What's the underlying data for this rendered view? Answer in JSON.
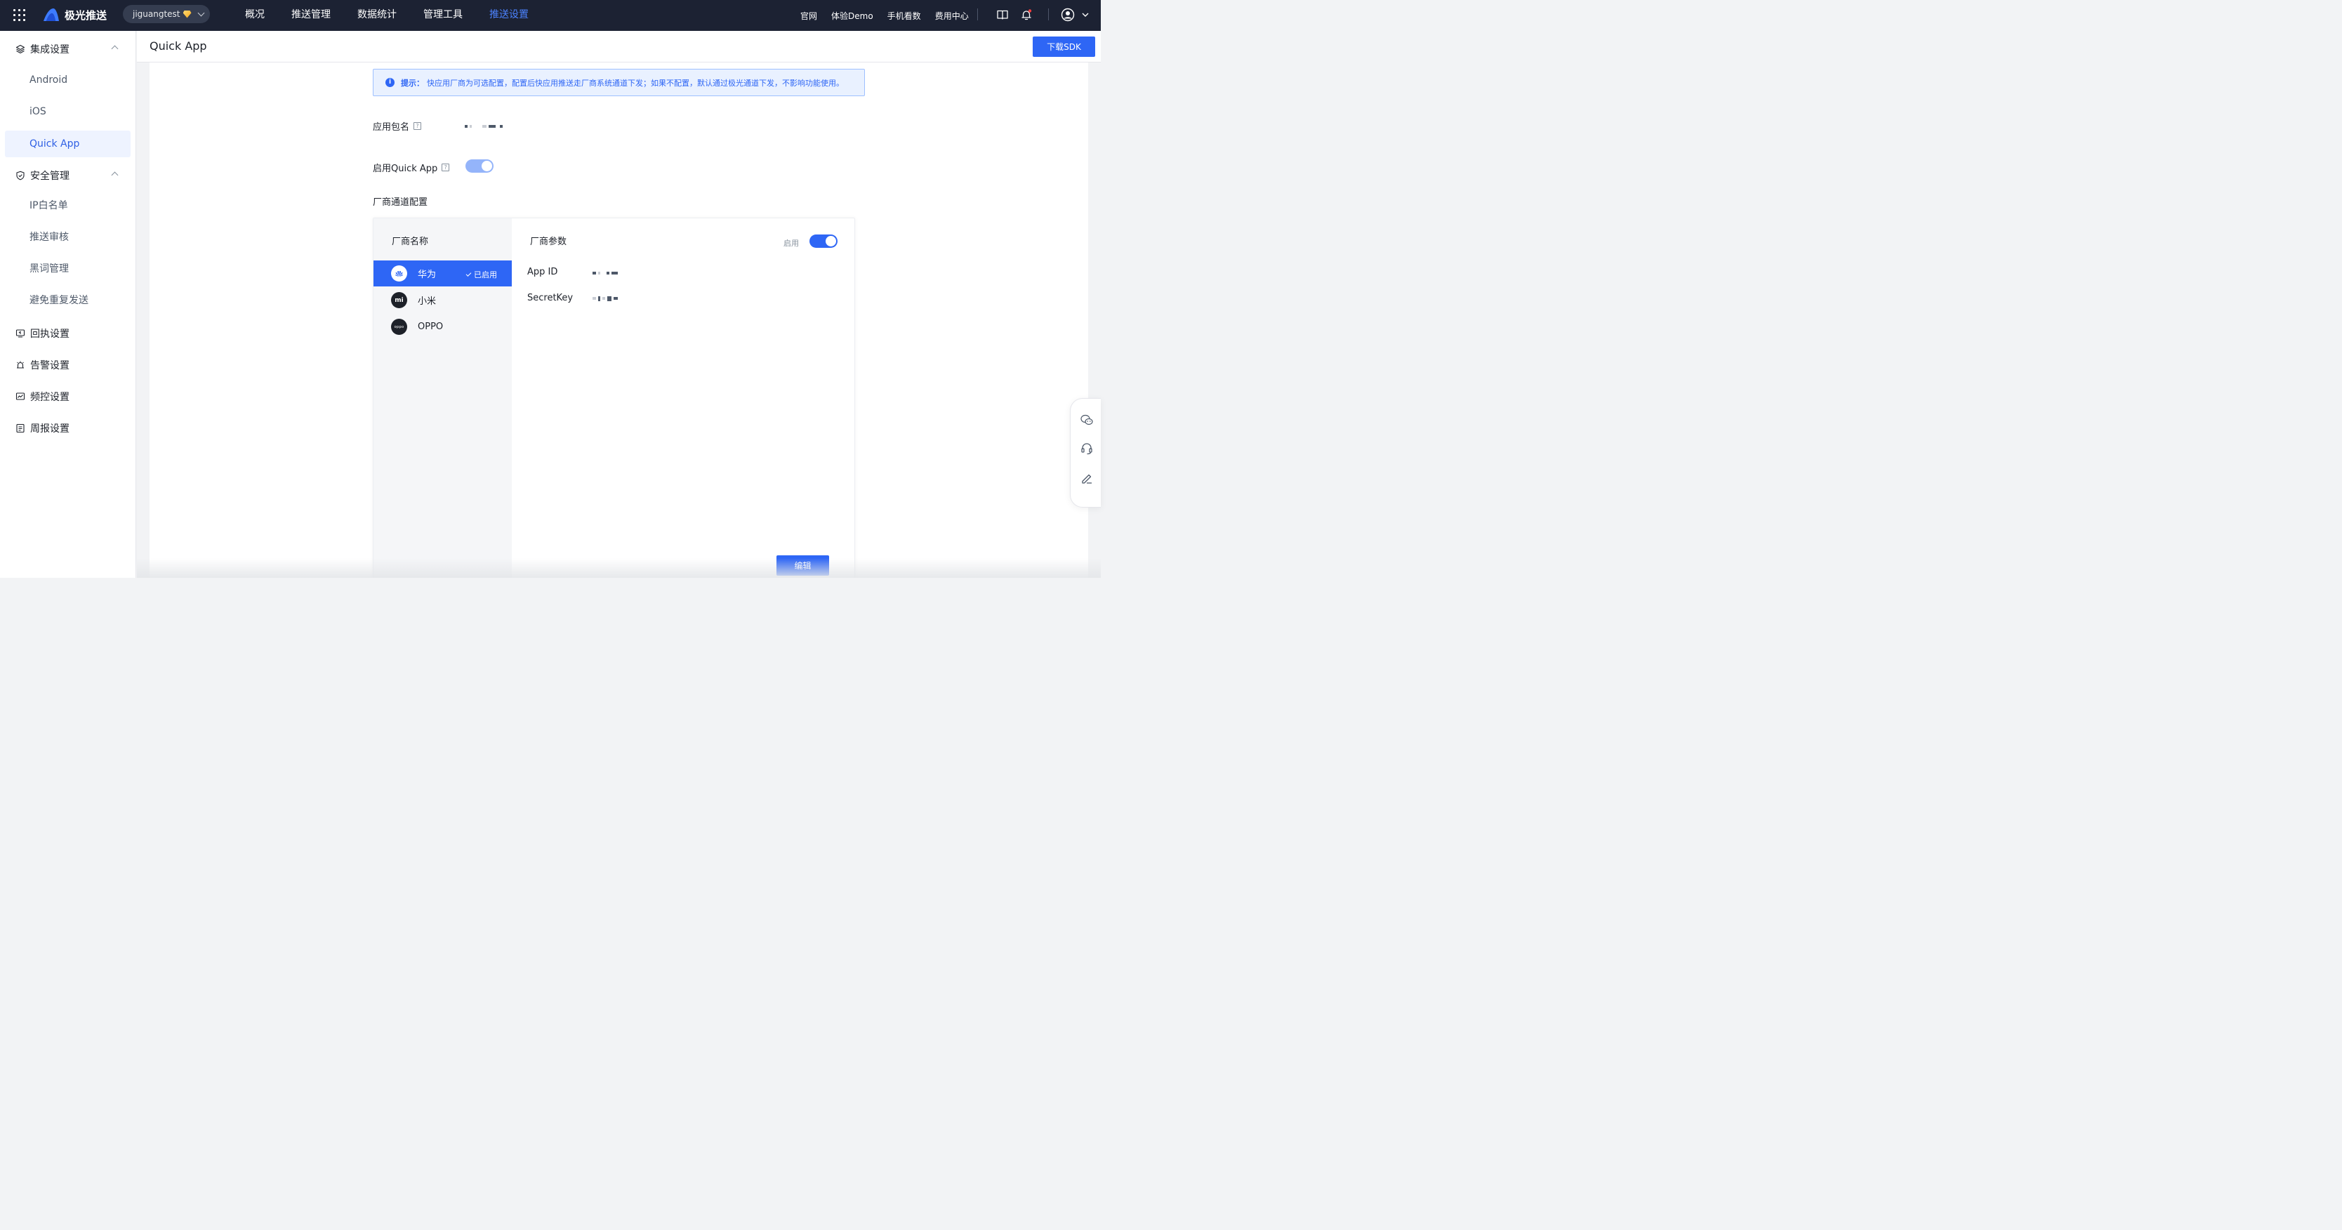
{
  "topbar": {
    "logo_text": "极光推送",
    "app_name": "jiguangtest",
    "nav": [
      {
        "label": "概况"
      },
      {
        "label": "推送管理"
      },
      {
        "label": "数据统计"
      },
      {
        "label": "管理工具"
      },
      {
        "label": "推送设置",
        "active": true
      }
    ],
    "links": [
      "官网",
      "体验Demo",
      "手机看数",
      "费用中心"
    ],
    "icons": [
      "apps-grid-icon",
      "book-icon",
      "bell-icon",
      "user-avatar-icon",
      "chevron-down-icon"
    ],
    "colors": {
      "background": "#1c2233",
      "active_nav": "#4c83ff",
      "notification_dot": "#f53f3f"
    }
  },
  "sidebar": {
    "groups": [
      {
        "label": "集成设置",
        "icon": "layers-icon",
        "expanded": true,
        "items": [
          {
            "label": "Android"
          },
          {
            "label": "iOS"
          },
          {
            "label": "Quick App",
            "active": true
          }
        ]
      },
      {
        "label": "安全管理",
        "icon": "shield-icon",
        "expanded": true,
        "items": [
          {
            "label": "IP白名单"
          },
          {
            "label": "推送审核"
          },
          {
            "label": "黑词管理"
          },
          {
            "label": "避免重复发送"
          }
        ]
      },
      {
        "label": "回执设置",
        "icon": "receipt-icon"
      },
      {
        "label": "告警设置",
        "icon": "alarm-icon"
      },
      {
        "label": "频控设置",
        "icon": "frequency-icon"
      },
      {
        "label": "周报设置",
        "icon": "report-icon"
      }
    ]
  },
  "page": {
    "title": "Quick App",
    "download_sdk": "下载SDK"
  },
  "tip": {
    "label": "提示：",
    "text": "快应用厂商为可选配置，配置后快应用推送走厂商系统通道下发；如果不配置，默认通过极光通道下发，不影响功能使用。"
  },
  "form": {
    "package_label": "应用包名",
    "enable_label": "启用Quick App",
    "enable_on": true,
    "vendor_section_title": "厂商通道配置"
  },
  "vendors": {
    "list_title": "厂商名称",
    "items": [
      {
        "name": "华为",
        "logo": "huawei-logo-icon",
        "enabled_tag": "已启用",
        "active": true
      },
      {
        "name": "小米",
        "logo": "xiaomi-logo-icon",
        "logo_text": "mi"
      },
      {
        "name": "OPPO",
        "logo": "oppo-logo-icon",
        "logo_text": "oppo"
      }
    ]
  },
  "params": {
    "title": "厂商参数",
    "enable_label": "启用",
    "enable_on": true,
    "fields": [
      {
        "label": "App ID"
      },
      {
        "label": "SecretKey"
      }
    ],
    "edit_button": "编辑"
  },
  "float_bar": {
    "icons": [
      "wechat-icon",
      "headset-support-icon",
      "edit-feedback-icon"
    ]
  },
  "colors": {
    "primary": "#2e66f5",
    "tip_bg": "#e9f1ff",
    "active_menu_bg": "#eef3ff"
  }
}
